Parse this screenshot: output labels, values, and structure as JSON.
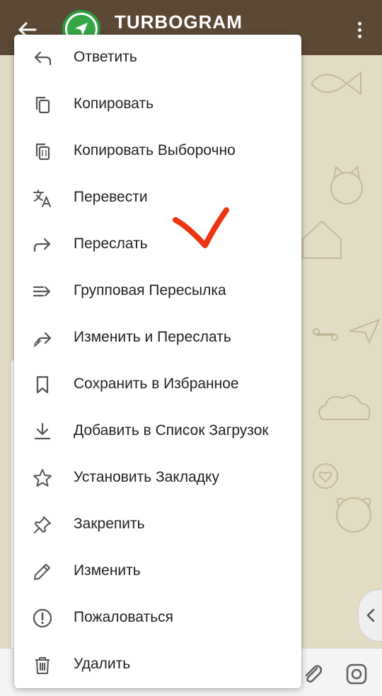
{
  "header": {
    "title": "TURBOGRAM",
    "bg_color": "#5b4935"
  },
  "menu": {
    "items": [
      {
        "label": "Ответить",
        "icon": "reply-icon"
      },
      {
        "label": "Копировать",
        "icon": "copy-icon"
      },
      {
        "label": "Копировать Выборочно",
        "icon": "copy-selective-icon"
      },
      {
        "label": "Перевести",
        "icon": "translate-icon"
      },
      {
        "label": "Переслать",
        "icon": "forward-icon"
      },
      {
        "label": "Групповая Пересылка",
        "icon": "group-forward-icon"
      },
      {
        "label": "Изменить и Переслать",
        "icon": "edit-forward-icon"
      },
      {
        "label": "Сохранить в Избранное",
        "icon": "bookmark-icon"
      },
      {
        "label": "Добавить в Список Загрузок",
        "icon": "download-icon"
      },
      {
        "label": "Установить Закладку",
        "icon": "star-icon"
      },
      {
        "label": "Закрепить",
        "icon": "pin-icon"
      },
      {
        "label": "Изменить",
        "icon": "pencil-icon"
      },
      {
        "label": "Пожаловаться",
        "icon": "report-icon"
      },
      {
        "label": "Удалить",
        "icon": "trash-icon"
      }
    ]
  },
  "annotation": {
    "color": "#ee3311",
    "icon": "red-checkmark-annotation"
  },
  "colors": {
    "chat_bg": "#e2dcc4",
    "avatar_green": "#35a845",
    "menu_text": "#222222",
    "icon_gray": "#555555"
  }
}
